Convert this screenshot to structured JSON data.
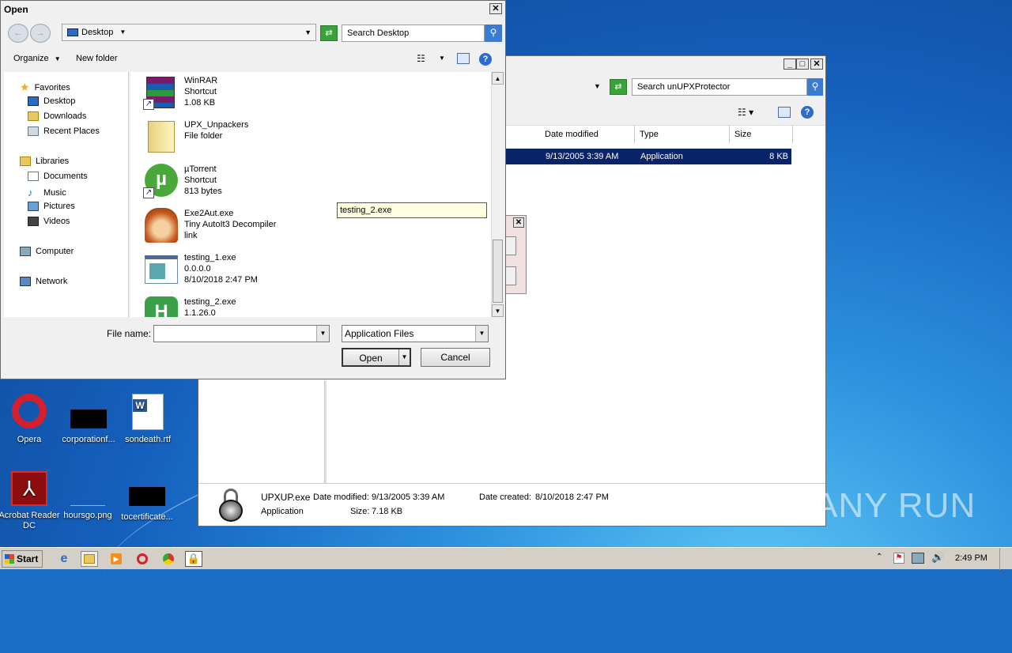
{
  "open_dialog": {
    "title": "Open",
    "location": "Desktop",
    "search_placeholder": "Search Desktop",
    "organize": "Organize",
    "new_folder": "New folder",
    "nav": {
      "favorites": "Favorites",
      "desktop": "Desktop",
      "downloads": "Downloads",
      "recent": "Recent Places",
      "libraries": "Libraries",
      "documents": "Documents",
      "music": "Music",
      "pictures": "Pictures",
      "videos": "Videos",
      "computer": "Computer",
      "network": "Network"
    },
    "files": [
      {
        "name": "WinRAR",
        "line2": "Shortcut",
        "line3": "1.08 KB"
      },
      {
        "name": "UPX_Unpackers",
        "line2": "File folder",
        "line3": ""
      },
      {
        "name": "µTorrent",
        "line2": "Shortcut",
        "line3": "813 bytes"
      },
      {
        "name": "Exe2Aut.exe",
        "line2": "Tiny AutoIt3 Decompiler",
        "line3": "link"
      },
      {
        "name": "testing_1.exe",
        "line2": "0.0.0.0",
        "line3": "8/10/2018 2:47 PM"
      },
      {
        "name": "testing_2.exe",
        "line2": "1.1.26.0",
        "line3": ""
      }
    ],
    "tooltip": "testing_2.exe",
    "filename_label": "File name:",
    "filename_value": "",
    "filetype": "Application Files",
    "open_btn": "Open",
    "cancel_btn": "Cancel"
  },
  "explorer": {
    "search_placeholder": "Search unUPXProtector",
    "columns": [
      "Date modified",
      "Type",
      "Size"
    ],
    "row": {
      "date": "9/13/2005 3:39 AM",
      "type": "Application",
      "size": "8 KB"
    },
    "details": {
      "name": "UPXUP.exe",
      "type": "Application",
      "date_modified_label": "Date modified:",
      "date_modified": "9/13/2005 3:39 AM",
      "size_label": "Size:",
      "size": "7.18 KB",
      "date_created_label": "Date created:",
      "date_created": "8/10/2018 2:47 PM"
    }
  },
  "desktop_icons": {
    "opera": "Opera",
    "corporation": "corporationf...",
    "sondeath": "sondeath.rtf",
    "acrobat": "Acrobat Reader DC",
    "hoursgo": "hoursgo.png",
    "tocertificate": "tocertificate..."
  },
  "watermark": "ANY RUN",
  "taskbar": {
    "start": "Start",
    "clock": "2:49 PM"
  }
}
